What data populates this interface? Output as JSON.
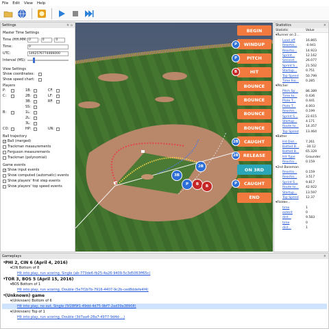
{
  "menu": [
    "File",
    "Edit",
    "View",
    "Help"
  ],
  "settings": {
    "title": "Settings",
    "master_time": "Master Time Settings",
    "time_label": "Time (HH:MM:SS):",
    "time_h": "0",
    "time_m": "0",
    "time_s": "0",
    "time2_label": "Time:",
    "time2_value": "0",
    "utc_label": "UTC:",
    "utc_value": "1462576774466000",
    "interval_label": "Interval (MS):",
    "view_settings": "View Settings",
    "show_coords": "Show coordinates:",
    "show_speed": "Show speed chart:",
    "players": "Players",
    "player_labels": [
      [
        "P:",
        "1B:",
        "CF:"
      ],
      [
        "C:",
        "2B:",
        "LF:"
      ],
      [
        "",
        "3B:",
        "RF:"
      ],
      [
        "",
        "SS:",
        ""
      ],
      [
        "B:",
        "1L:",
        ""
      ],
      [
        "",
        "2L:",
        ""
      ],
      [
        "",
        "3L:",
        ""
      ],
      [
        "CO:",
        "HP:",
        "UN:"
      ]
    ],
    "ball_trajectory": "Ball trajectory",
    "traj": [
      {
        "label": "Ball (merged)",
        "on": true
      },
      {
        "label": "Trackman measurements",
        "on": false
      },
      {
        "label": "Ferguson measurements",
        "on": false
      },
      {
        "label": "Trackman (polynomial)",
        "on": false
      }
    ],
    "game_events": "Game events",
    "events": [
      {
        "label": "Show input events",
        "on": true
      },
      {
        "label": "Show computed (automatic) events",
        "on": false
      },
      {
        "label": "Show players' first step events",
        "on": false
      },
      {
        "label": "Show players' top speed events",
        "on": false
      }
    ]
  },
  "field_events": [
    {
      "label": "BEGIN",
      "badge": "",
      "color": "orange"
    },
    {
      "label": "WINDUP",
      "badge": "P",
      "color": "orange"
    },
    {
      "label": "PITCH",
      "badge": "P",
      "color": "orange"
    },
    {
      "label": "HIT",
      "badge": "B",
      "color": "orange"
    },
    {
      "label": "BOUNCE",
      "badge": "",
      "color": "orange"
    },
    {
      "label": "BOUNCE",
      "badge": "",
      "color": "orange"
    },
    {
      "label": "BOUNCE",
      "badge": "",
      "color": "orange"
    },
    {
      "label": "BOUNCE",
      "badge": "",
      "color": "orange"
    },
    {
      "label": "CAUGHT",
      "badge": "2B",
      "color": "orange"
    },
    {
      "label": "RELEASE",
      "badge": "2B",
      "color": "orange"
    },
    {
      "label": "ON 3RD",
      "badge": "",
      "color": "teal"
    },
    {
      "label": "CAUGHT",
      "badge": "P",
      "color": "orange"
    },
    {
      "label": "END",
      "badge": "",
      "color": "orange"
    }
  ],
  "field_players": [
    {
      "label": "2B",
      "color": "blue"
    },
    {
      "label": "3B",
      "color": "blue"
    },
    {
      "label": "P",
      "color": "blue"
    },
    {
      "label": "B",
      "color": "red"
    },
    {
      "label": "B",
      "color": "red"
    }
  ],
  "statistics": {
    "title": "Statistics",
    "col_stat": "Statistic",
    "col_value": "Value",
    "groups": [
      {
        "name": "Runner on 2...",
        "rows": [
          [
            "Lead off",
            "16.865"
          ],
          [
            "Reactio...",
            "-0.941"
          ],
          [
            "Reactio...",
            "14.923"
          ],
          [
            "Sprint...",
            "12.162"
          ],
          [
            "Second...",
            "26.077"
          ],
          [
            "Sprint S...",
            "21.502"
          ],
          [
            "Startup...",
            "0.751"
          ],
          [
            "Top Speed",
            "50.799"
          ],
          [
            "Time Fro...",
            "0.285"
          ]
        ]
      },
      {
        "name": "Pitcher",
        "rows": [
          [
            "Pitch Sp...",
            "86.389"
          ],
          [
            "Time to...",
            "0.436"
          ],
          [
            "Plate T...",
            "0.441"
          ],
          [
            "Plate T...",
            "4.003"
          ],
          [
            "Reactio...",
            "0.199"
          ],
          [
            "Sprint S...",
            "22.615"
          ],
          [
            "Startup...",
            "4.171"
          ],
          [
            "Route to...",
            "14.357"
          ],
          [
            "Top Speed",
            "13.464"
          ]
        ]
      },
      {
        "name": "Batter",
        "rows": [
          [
            "Hit Dist...",
            "7.261"
          ],
          [
            "Batted B...",
            "-30.12"
          ],
          [
            "Batted B...",
            "65.329"
          ],
          [
            "Hit Type",
            "Grounder"
          ],
          [
            "Reactio...",
            "0.159"
          ]
        ]
      },
      {
        "name": "2nd Baseman",
        "rows": [
          [
            "Reactio...",
            "0.159"
          ],
          [
            "Reactio...",
            "3.517"
          ],
          [
            "Sprint S...",
            "9.817"
          ],
          [
            "Route to...",
            "42.922"
          ],
          [
            "Startup...",
            "13.597"
          ],
          [
            "Top Speed",
            "12.37"
          ]
        ]
      },
      {
        "name": "Fielder...",
        "rows": [
          [
            "time",
            "1"
          ],
          [
            "extent",
            "0"
          ],
          [
            "dist...",
            "9.583"
          ],
          [
            "time",
            "0"
          ],
          [
            "dist...",
            "1"
          ]
        ]
      }
    ]
  },
  "gameplays": {
    "title": "Gameplays",
    "items": [
      {
        "level": 0,
        "text": "PHI 2, CIN 6 (April 4, 2016)",
        "bold": true,
        "link": false
      },
      {
        "level": 1,
        "text": "CIN Bottom of 8",
        "bold": false,
        "link": false
      },
      {
        "level": 2,
        "text": "Hit into play, run scoring, Single (ab-773de6-fb25-4a26-9409-5c3d5063ff65c)",
        "bold": false,
        "link": true
      },
      {
        "level": 0,
        "text": "TOR 3, BOS 5 (April 15, 2016)",
        "bold": true,
        "link": false
      },
      {
        "level": 1,
        "text": "BOS Bottom of 1",
        "bold": false,
        "link": false
      },
      {
        "level": 2,
        "text": "Hit into play, run scoring, Double (5e7f1b7b-7916-4407-9c2b-ced8ddefe4f4)",
        "bold": false,
        "link": true
      },
      {
        "level": 0,
        "text": "(Unknown) game",
        "bold": true,
        "link": false
      },
      {
        "level": 1,
        "text": "(Unknown) Bottom of 6",
        "bold": false,
        "link": false
      },
      {
        "level": 2,
        "text": "Hit into play, no out, Single (5f28f9f1-49dd-4d75-9bf7-2ad39a38908)",
        "bold": false,
        "link": true,
        "selected": true
      },
      {
        "level": 1,
        "text": "(Unknown) Top of 1",
        "bold": false,
        "link": false
      },
      {
        "level": 2,
        "text": "Hit into play, run scoring, Double (3d7aa4-28a7-4977-9d4d-...)",
        "bold": false,
        "link": true
      }
    ]
  },
  "colors": {
    "orange": "#f27a3e",
    "blue": "#2d7fd0",
    "teal": "#2aa6b8",
    "red": "#c62828",
    "grass": "#3f6b2e",
    "dirt": "#b9876a"
  }
}
